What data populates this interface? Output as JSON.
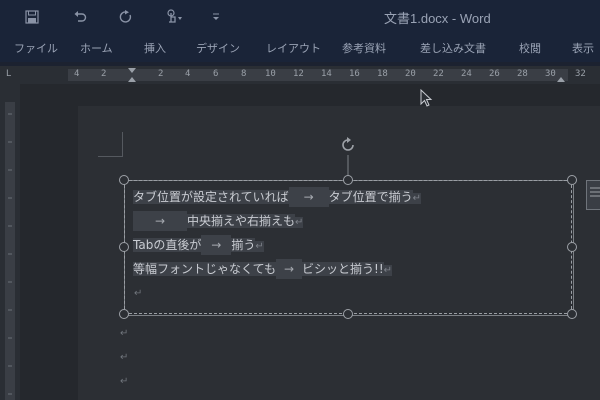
{
  "window": {
    "title": "文書1.docx  -  Word"
  },
  "quick_access": {
    "save_icon": "save-icon",
    "undo_icon": "undo-icon",
    "redo_icon": "redo-icon",
    "touch_icon": "touch-mode-icon",
    "customize_icon": "customize-icon"
  },
  "ribbon": {
    "tabs": [
      "ファイル",
      "ホーム",
      "挿入",
      "デザイン",
      "レイアウト",
      "参考資料",
      "差し込み文書",
      "校閲",
      "表示"
    ]
  },
  "ruler": {
    "numbers": [
      "4",
      "2",
      "2",
      "4",
      "6",
      "8",
      "10",
      "12",
      "14",
      "16",
      "18",
      "20",
      "22",
      "24",
      "26",
      "28",
      "30",
      "32"
    ],
    "corner": "L"
  },
  "document": {
    "lines": [
      {
        "a": "タブ位置が設定されていれば",
        "b": "タブ位置で揃う"
      },
      {
        "a": "",
        "b": "中央揃えや右揃えも"
      },
      {
        "a": "Tabの直後が",
        "b": "揃う"
      },
      {
        "a": "等幅フォントじゃなくても",
        "b": "ビシッと揃う!!"
      }
    ],
    "arrow": "→",
    "para_mark": "↵"
  },
  "colors": {
    "titlebar": "#1a2438",
    "canvas": "#25282d",
    "text": "#c9ccd2"
  }
}
